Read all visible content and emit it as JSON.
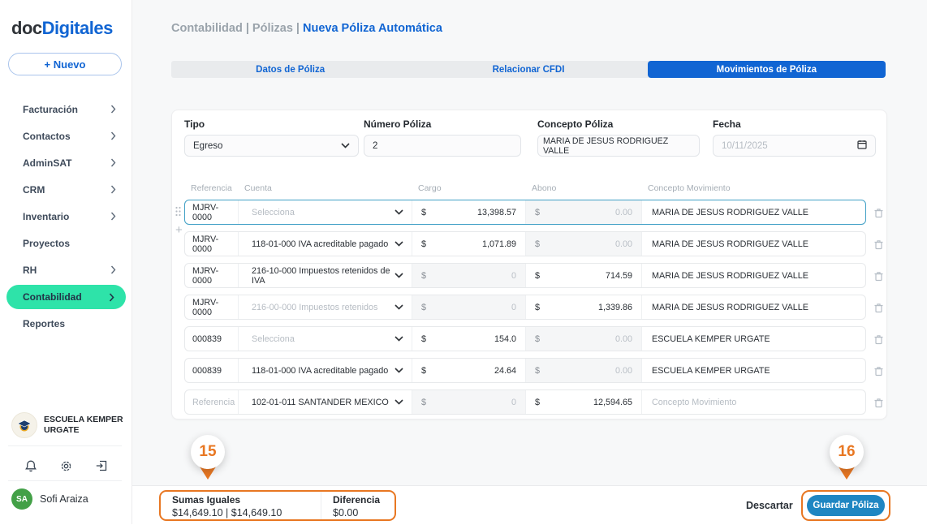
{
  "colors": {
    "brand_blue": "#1165d3",
    "active_menu_green": "#2ee3a9",
    "annotation_orange": "#e87722",
    "focused_row_border": "#41a0c6",
    "save_button_blue": "#1f86c2"
  },
  "brand": {
    "logo_prefix": "doc",
    "logo_suffix": "Digitales",
    "new_button_label": "+ Nuevo"
  },
  "sidebar": {
    "items": [
      {
        "label": "Facturación",
        "has_chevron": true
      },
      {
        "label": "Contactos",
        "has_chevron": true
      },
      {
        "label": "AdminSAT",
        "has_chevron": true
      },
      {
        "label": "CRM",
        "has_chevron": true
      },
      {
        "label": "Inventario",
        "has_chevron": true
      },
      {
        "label": "Proyectos",
        "has_chevron": false
      },
      {
        "label": "RH",
        "has_chevron": true
      },
      {
        "label": "Contabilidad",
        "has_chevron": true,
        "active": true
      },
      {
        "label": "Reportes",
        "has_chevron": false
      }
    ],
    "organization": "ESCUELA KEMPER URGATE",
    "user_initials": "SA",
    "user_name": "Sofi Araiza"
  },
  "breadcrumb": {
    "trail": "Contabilidad | Pólizas |",
    "current": "Nueva Póliza Automática"
  },
  "tabs": [
    {
      "label": "Datos de Póliza",
      "active": false
    },
    {
      "label": "Relacionar CFDI",
      "active": false
    },
    {
      "label": "Movimientos de Póliza",
      "active": true
    }
  ],
  "form": {
    "tipo_label": "Tipo",
    "tipo_value": "Egreso",
    "numero_label": "Número Póliza",
    "numero_value": "2",
    "concepto_label": "Concepto Póliza",
    "concepto_value": "MARIA DE JESUS RODRIGUEZ VALLE",
    "fecha_label": "Fecha",
    "fecha_value": "10/11/2025"
  },
  "table": {
    "headers": {
      "referencia": "Referencia",
      "cuenta": "Cuenta",
      "cargo": "Cargo",
      "abono": "Abono",
      "concepto": "Concepto Movimiento"
    },
    "currency_symbol": "$",
    "rows": [
      {
        "referencia": "MJRV-0000",
        "cuenta": "Selecciona",
        "cargo": "13,398.57",
        "abono": "0.00",
        "concepto": "MARIA DE JESUS RODRIGUEZ VALLE"
      },
      {
        "referencia": "MJRV-0000",
        "cuenta": "118-01-000 IVA acreditable pagado",
        "cargo": "1,071.89",
        "abono": "0.00",
        "concepto": "MARIA DE JESUS RODRIGUEZ VALLE"
      },
      {
        "referencia": "MJRV-0000",
        "cuenta": "216-10-000 Impuestos retenidos de IVA",
        "cargo": "0",
        "abono": "714.59",
        "concepto": "MARIA DE JESUS RODRIGUEZ VALLE"
      },
      {
        "referencia": "MJRV-0000",
        "cuenta": "216-00-000 Impuestos retenidos",
        "cargo": "0",
        "abono": "1,339.86",
        "concepto": "MARIA DE JESUS RODRIGUEZ VALLE"
      },
      {
        "referencia": "000839",
        "cuenta": "Selecciona",
        "cargo": "154.0",
        "abono": "0.00",
        "concepto": "ESCUELA KEMPER URGATE"
      },
      {
        "referencia": "000839",
        "cuenta": "118-01-000 IVA acreditable pagado",
        "cargo": "24.64",
        "abono": "0.00",
        "concepto": "ESCUELA KEMPER URGATE"
      },
      {
        "referencia": "Referencia",
        "cuenta": "102-01-011 SANTANDER MEXICO",
        "cargo": "0",
        "abono": "12,594.65",
        "concepto": "Concepto Movimiento"
      }
    ]
  },
  "totals": {
    "sumas_label": "Sumas Iguales",
    "sumas_value": "$14,649.10 | $14,649.10",
    "diferencia_label": "Diferencia",
    "diferencia_value": "$0.00"
  },
  "actions": {
    "descartar_label": "Descartar",
    "guardar_label": "Guardar Póliza"
  },
  "annotations": {
    "step_15": "15",
    "step_16": "16"
  },
  "icons": {
    "menu_chevron": "chevron-right",
    "select_chevron": "chevron-down",
    "date_icon": "calendar",
    "notifications": "bell",
    "settings": "gear",
    "logout": "exit-door",
    "row_delete": "trash",
    "row_drag": "drag-dots",
    "row_add": "plus"
  }
}
